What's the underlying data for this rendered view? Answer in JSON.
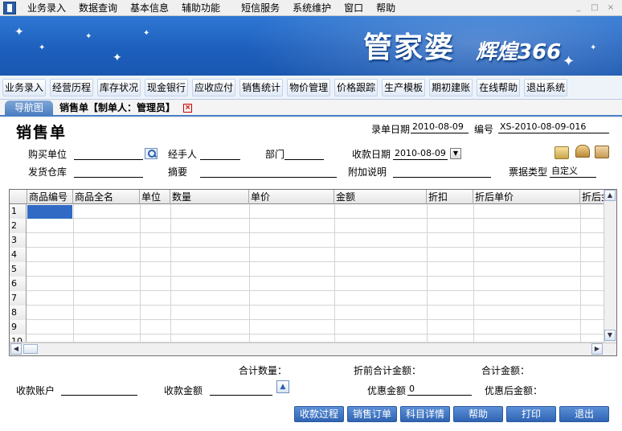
{
  "menu": [
    "业务录入",
    "数据查询",
    "基本信息",
    "辅助功能",
    "短信服务",
    "系统维护",
    "窗口",
    "帮助"
  ],
  "window_buttons": [
    "_",
    "□",
    "×"
  ],
  "banner": {
    "brand": "管家婆",
    "brand_sub": "辉煌366"
  },
  "toolbar": [
    "业务录入",
    "经营历程",
    "库存状况",
    "现金银行",
    "应收应付",
    "销售统计",
    "物价管理",
    "价格跟踪",
    "生产模板",
    "期初建账",
    "在线帮助",
    "退出系统"
  ],
  "tabs": {
    "nav_label": "导航图",
    "doc_label": "销售单【制单人：管理员】",
    "close": "×"
  },
  "form": {
    "title": "销售单",
    "entry_date_label": "录单日期",
    "entry_date": "2010-08-09",
    "number_label": "编号",
    "number": "XS-2010-08-09-016",
    "buyer_label": "购买单位",
    "buyer": "",
    "handler_label": "经手人",
    "handler": "",
    "dept_label": "部门",
    "dept": "",
    "collect_date_label": "收款日期",
    "collect_date": "2010-08-09",
    "warehouse_label": "发货仓库",
    "warehouse": "",
    "summary_label": "摘要",
    "summary": "",
    "note_label": "附加说明",
    "note": "",
    "ticket_type_label": "票据类型",
    "ticket_type": "自定义"
  },
  "grid": {
    "columns": [
      "商品编号",
      "商品全名",
      "单位",
      "数量",
      "单价",
      "金额",
      "折扣",
      "折后单价",
      "折后金"
    ],
    "row_numbers": [
      "1",
      "2",
      "3",
      "4",
      "5",
      "6",
      "7",
      "8",
      "9",
      "10"
    ]
  },
  "totals": {
    "qty_label": "合计数量：",
    "pre_discount_label": "折前合计金额：",
    "total_label": "合计金额：",
    "account_label": "收款账户",
    "account": "",
    "collect_amount_label": "收款金额",
    "collect_amount": "",
    "discount_label": "优惠金额",
    "discount": "0",
    "after_discount_label": "优惠后金额："
  },
  "actions": [
    "收款过程",
    "销售订单",
    "科目详情",
    "帮助",
    "打印",
    "退出"
  ],
  "colors": {
    "accent": "#2f64b3",
    "banner": "#1d5fbd",
    "selection": "#316ac5"
  }
}
